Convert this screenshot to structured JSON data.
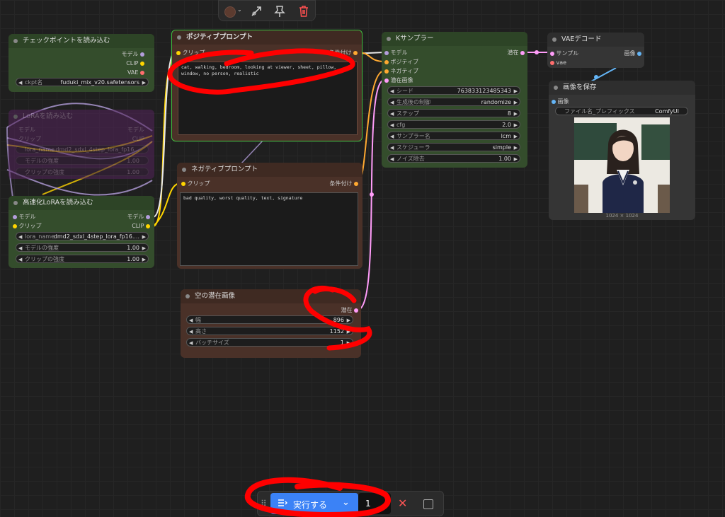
{
  "toolbar": {
    "color_icon": "color-circle-icon",
    "color": "#5c3b2f",
    "bypass_icon": "bypass-icon",
    "pin_icon": "pin-icon",
    "delete_icon": "trash-icon"
  },
  "nodes": {
    "checkpoint": {
      "title": "チェックポイントを読み込む",
      "outputs": [
        "モデル",
        "CLIP",
        "VAE"
      ],
      "ckpt_label": "ckpt名",
      "ckpt_value": "fuduki_mix_v20.safetensors"
    },
    "lora_faded": {
      "title": "LoRAを読み込む",
      "in_model": "モデル",
      "in_clip": "クリップ",
      "out_model": "モデル",
      "out_clip": "CLIP",
      "w1_label": "lora_name",
      "w1_value": "dmd2_sdxl_4step_lora_fp16...",
      "w2_label": "モデルの強度",
      "w2_value": "1.00",
      "w3_label": "クリップの強度",
      "w3_value": "1.00"
    },
    "fast_lora": {
      "title": "高速化LoRAを読み込む",
      "in_model": "モデル",
      "in_clip": "クリップ",
      "out_model": "モデル",
      "out_clip": "CLIP",
      "w1_label": "lora_name",
      "w1_value": "dmd2_sdxl_4step_lora_fp16....",
      "w2_label": "モデルの強度",
      "w2_value": "1.00",
      "w3_label": "クリップの強度",
      "w3_value": "1.00"
    },
    "positive": {
      "title": "ポジティブプロンプト",
      "in_clip": "クリップ",
      "out": "条件付け",
      "text": "cat, walking, bedroom, looking at viewer, sheet, pillow, window, no person, realistic"
    },
    "negative": {
      "title": "ネガティブプロンプト",
      "in_clip": "クリップ",
      "out": "条件付け",
      "text": "bad quality, worst quality, text, signature"
    },
    "latent": {
      "title": "空の潜在画像",
      "out": "潜在",
      "w1_label": "幅",
      "w1_value": "896",
      "w2_label": "高さ",
      "w2_value": "1152",
      "w3_label": "バッチサイズ",
      "w3_value": "1"
    },
    "ksampler": {
      "title": "Kサンプラー",
      "in_model": "モデル",
      "in_positive": "ポジティブ",
      "in_negative": "ネガティブ",
      "in_latent": "潜在画像",
      "out": "潜在",
      "widgets": [
        {
          "label": "シード",
          "value": "763833123485343"
        },
        {
          "label": "生成後の制御",
          "value": "randomize"
        },
        {
          "label": "ステップ",
          "value": "8"
        },
        {
          "label": "cfg",
          "value": "2.0"
        },
        {
          "label": "サンプラー名",
          "value": "lcm"
        },
        {
          "label": "スケジューラ",
          "value": "simple"
        },
        {
          "label": "ノイズ除去",
          "value": "1.00"
        }
      ]
    },
    "vae_decode": {
      "title": "VAEデコード",
      "in_samples": "サンプル",
      "in_vae": "vae",
      "out": "画像"
    },
    "save_image": {
      "title": "画像を保存",
      "in_images": "画像",
      "prefix_label": "ファイル名_プレフィックス",
      "prefix_value": "ComfyUI",
      "image_size": "1024 × 1024"
    }
  },
  "bottom": {
    "run_label": "実行する",
    "count": "1"
  },
  "colors": {
    "model": "#b39ddb",
    "clip": "#ffd500",
    "vae": "#ff6e6e",
    "latent": "#ff9cf9",
    "conditioning": "#ffa931",
    "image": "#64b5f6",
    "annotation": "#ff0000"
  }
}
